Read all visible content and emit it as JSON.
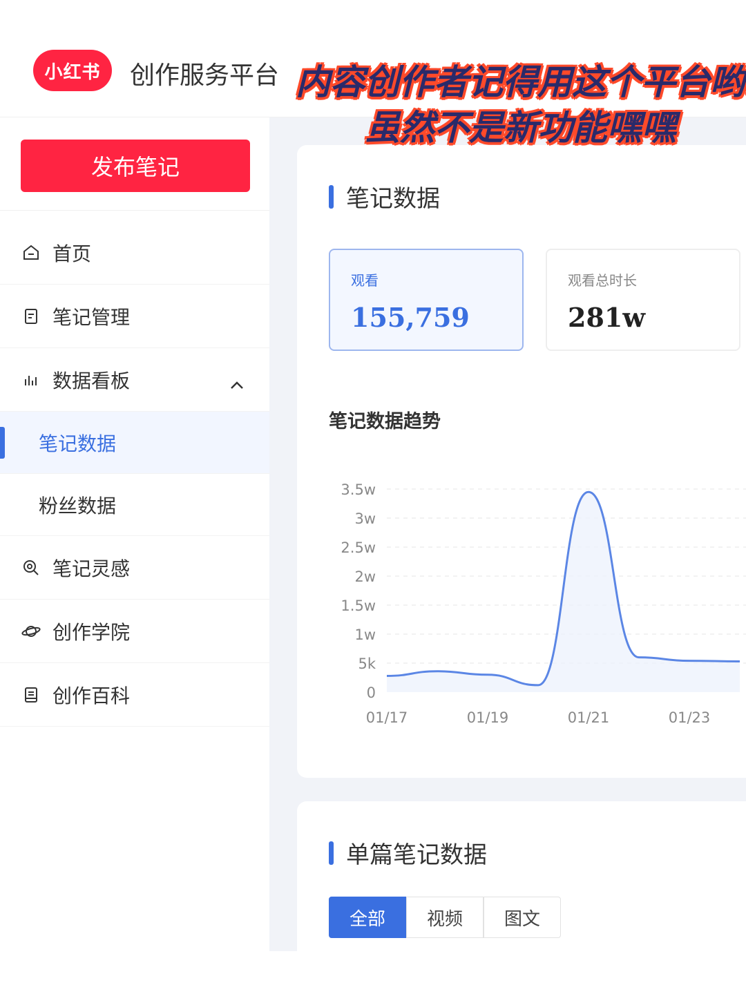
{
  "header": {
    "logo_text": "小红书",
    "platform_title": "创作服务平台"
  },
  "overlay": {
    "line1": "内容创作者记得用这个平台哟!",
    "line2": "虽然不是新功能嘿嘿"
  },
  "sidebar": {
    "publish_button": "发布笔记",
    "items": [
      {
        "label": "首页",
        "icon": "home-icon"
      },
      {
        "label": "笔记管理",
        "icon": "document-icon"
      },
      {
        "label": "数据看板",
        "icon": "bar-chart-icon",
        "expanded": true
      },
      {
        "label": "笔记数据",
        "sub": true,
        "active": true
      },
      {
        "label": "粉丝数据",
        "sub": true
      },
      {
        "label": "笔记灵感",
        "icon": "search-idea-icon"
      },
      {
        "label": "创作学院",
        "icon": "planet-icon"
      },
      {
        "label": "创作百科",
        "icon": "book-icon"
      }
    ]
  },
  "main": {
    "section_title": "笔记数据",
    "metrics": [
      {
        "label": "观看",
        "value": "155,759",
        "active": true
      },
      {
        "label": "观看总时长",
        "value": "281w",
        "active": false
      }
    ],
    "trend_title": "笔记数据趋势",
    "single_section_title": "单篇笔记数据",
    "tabs": [
      "全部",
      "视频",
      "图文"
    ],
    "active_tab": "全部"
  },
  "colors": {
    "brand_red": "#ff2442",
    "accent_blue": "#3a6fe0"
  },
  "chart_data": {
    "type": "line",
    "x": [
      "01/17",
      "01/18",
      "01/19",
      "01/20",
      "01/21",
      "01/22",
      "01/23",
      "01/24"
    ],
    "x_tick_labels": [
      "01/17",
      "01/19",
      "01/21",
      "01/23"
    ],
    "series": [
      {
        "values": [
          2800,
          3600,
          3000,
          1200,
          34500,
          6000,
          5400,
          5300
        ]
      }
    ],
    "y_tick_labels": [
      "0",
      "5k",
      "1w",
      "1.5w",
      "2w",
      "2.5w",
      "3w",
      "3.5w"
    ],
    "ylim": [
      0,
      35000
    ],
    "grid": true
  }
}
